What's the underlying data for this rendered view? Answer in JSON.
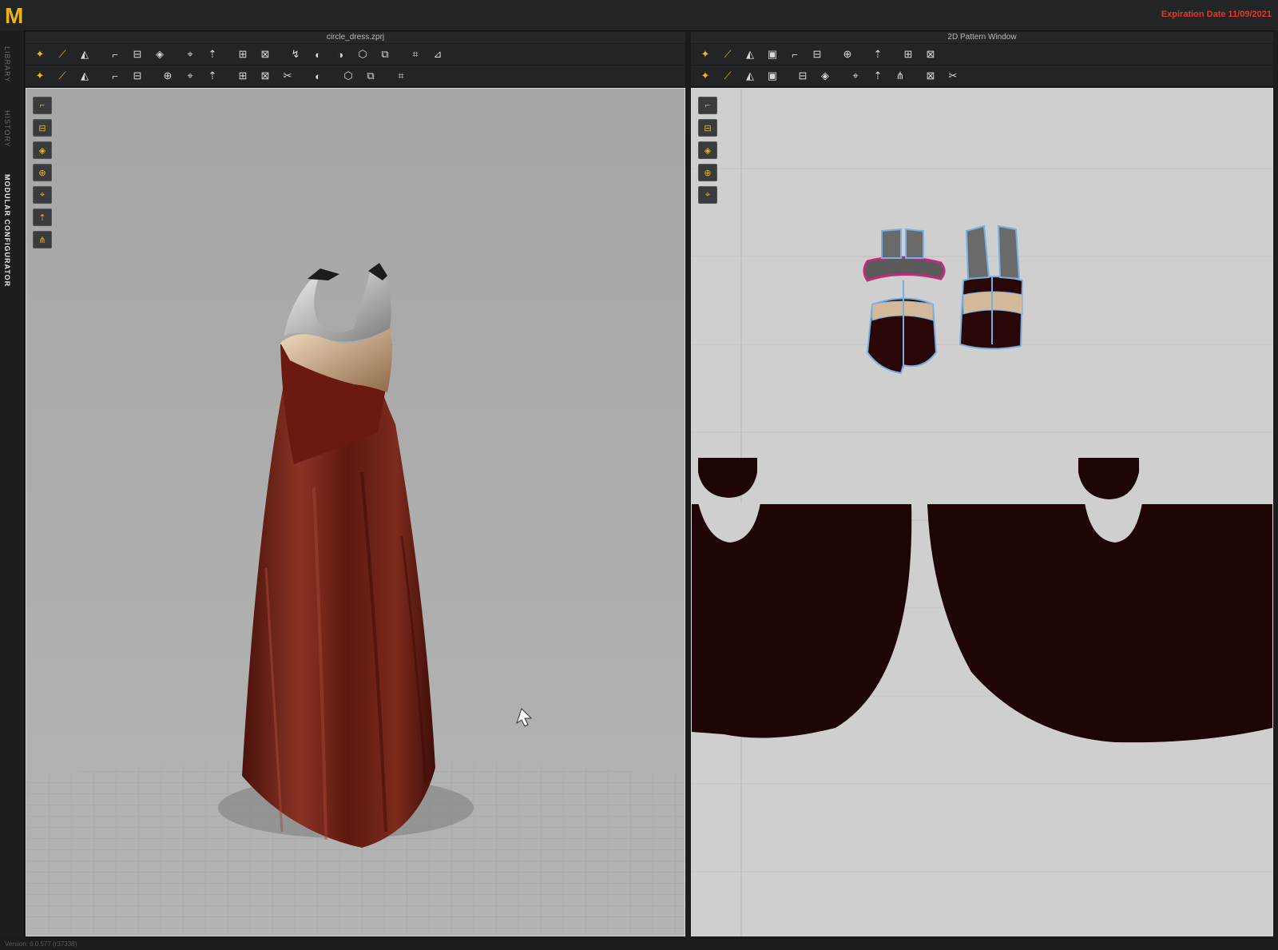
{
  "app": {
    "logo": "M",
    "expiration": "Expiration Date 11/09/2021"
  },
  "sidebar": {
    "tabs": [
      {
        "label": "LIBRARY"
      },
      {
        "label": "HISTORY"
      },
      {
        "label": "MODULAR CONFIGURATOR"
      }
    ]
  },
  "panel3d": {
    "title": "circle_dress.zprj",
    "row1": [
      "drop-arrow-icon",
      "split-icon",
      "edit-point-icon",
      "sep",
      "select-mesh-icon",
      "fold-icon",
      "fold-2-icon",
      "sep",
      "pin-icon",
      "move-icon",
      "sep",
      "measure-icon",
      "bind-icon",
      "sep",
      "avatar-fit-icon",
      "garment-icon",
      "shirt-icon",
      "arrow-up-icon",
      "arrow-up-2-icon",
      "sep",
      "grid-icon",
      "grid-2-icon"
    ],
    "row2": [
      "walk-icon",
      "needle-icon",
      "pin-x-icon",
      "sep",
      "tack-icon",
      "scissor-icon",
      "sep",
      "pin-d-icon",
      "pin-e-icon",
      "pin-f-icon",
      "sep",
      "circle-a-icon",
      "circle-b-icon",
      "circle-c-icon",
      "sep",
      "sew-icon",
      "sep",
      "board-a-icon",
      "board-b-icon",
      "sep",
      "axis-icon"
    ],
    "side_tools": [
      "avatar-icon",
      "display-a-icon",
      "display-b-icon",
      "display-c-icon",
      "display-d-icon",
      "display-e-icon",
      "display-f-icon"
    ]
  },
  "panel2d": {
    "title": "2D Pattern Window",
    "row1": [
      "transform-icon",
      "curve-icon",
      "rect-icon",
      "circle-icon",
      "box-icon",
      "copy-icon",
      "sep",
      "stripes-icon",
      "sep",
      "figure-icon",
      "sep",
      "grid-icon",
      "grid-2-icon"
    ],
    "row2": [
      "trim-a-icon",
      "trim-b-icon",
      "trim-c-icon",
      "trim-d-icon",
      "sep",
      "notch-icon",
      "fold-pattern-icon",
      "sep",
      "pleat-a-icon",
      "pleat-b-icon",
      "pleat-c-icon",
      "sep",
      "line-icon",
      "dash-icon"
    ],
    "side_tools": [
      "pen-icon",
      "shirt-2d-icon",
      "info-icon",
      "texture-icon",
      "ghost-icon"
    ]
  },
  "colors": {
    "dress": "#6b1e14",
    "pattern": "#1e0404",
    "outline": "#7aaee0",
    "accent": "#f2b21b",
    "expiry": "#e03a2f"
  },
  "status": {
    "text": "Version: 6.0.577 (r37338)"
  }
}
